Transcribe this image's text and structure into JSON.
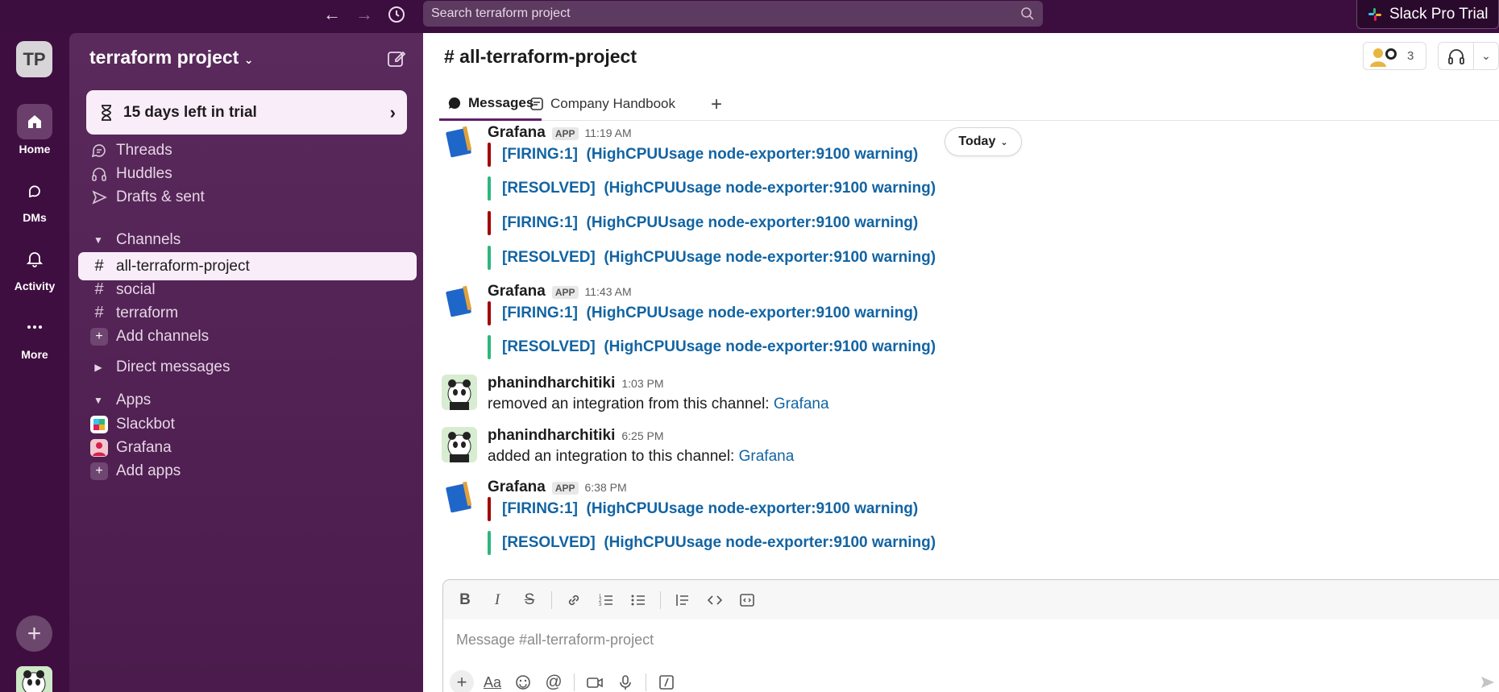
{
  "topbar": {
    "search_placeholder": "Search terraform project",
    "trial_label": "Slack Pro Trial",
    "icons": [
      "back-arrow-icon",
      "forward-arrow-icon",
      "history-clock-icon",
      "search-icon",
      "slack-logo-icon"
    ]
  },
  "rail": {
    "workspace_initials": "TP",
    "items": [
      {
        "label": "Home",
        "icon": "home-icon",
        "active": true
      },
      {
        "label": "DMs",
        "icon": "dms-icon",
        "active": false
      },
      {
        "label": "Activity",
        "icon": "bell-icon",
        "active": false
      },
      {
        "label": "More",
        "icon": "more-dots-icon",
        "active": false
      }
    ]
  },
  "sidebar": {
    "workspace_name": "terraform project",
    "trial_banner": "15 days left in trial",
    "nav": [
      {
        "label": "Threads",
        "icon": "threads-icon"
      },
      {
        "label": "Huddles",
        "icon": "headphones-icon"
      },
      {
        "label": "Drafts & sent",
        "icon": "send-icon"
      }
    ],
    "channels_header": "Channels",
    "channels": [
      {
        "label": "all-terraform-project",
        "active": true
      },
      {
        "label": "social",
        "active": false
      },
      {
        "label": "terraform",
        "active": false
      }
    ],
    "add_channels": "Add channels",
    "dm_header": "Direct messages",
    "apps_header": "Apps",
    "apps": [
      {
        "label": "Slackbot",
        "icon": "slackbot-icon"
      },
      {
        "label": "Grafana",
        "icon": "grafana-app-icon"
      }
    ],
    "add_apps": "Add apps"
  },
  "main": {
    "channel_title": "# all-terraform-project",
    "member_count": "3",
    "tabs": [
      {
        "label": "Messages",
        "active": true
      },
      {
        "label": "Company Handbook",
        "active": false
      }
    ],
    "date_divider": "Today",
    "messages": [
      {
        "author": "Grafana",
        "tag": "APP",
        "time": "11:19 AM",
        "alerts": [
          {
            "status": "[FIRING:1]",
            "text": "(HighCPUUsage node-exporter:9100 warning)",
            "color": "#a30200"
          },
          {
            "status": "[RESOLVED]",
            "text": "(HighCPUUsage node-exporter:9100 warning)",
            "color": "#2eb67d"
          },
          {
            "status": "[FIRING:1]",
            "text": "(HighCPUUsage node-exporter:9100 warning)",
            "color": "#a30200"
          },
          {
            "status": "[RESOLVED]",
            "text": "(HighCPUUsage node-exporter:9100 warning)",
            "color": "#2eb67d"
          }
        ]
      },
      {
        "author": "Grafana",
        "tag": "APP",
        "time": "11:43 AM",
        "alerts": [
          {
            "status": "[FIRING:1]",
            "text": "(HighCPUUsage node-exporter:9100 warning)",
            "color": "#a30200"
          },
          {
            "status": "[RESOLVED]",
            "text": "(HighCPUUsage node-exporter:9100 warning)",
            "color": "#2eb67d"
          }
        ]
      },
      {
        "author": "phanindharchitiki",
        "time": "1:03 PM",
        "text": "removed an integration from this channel:",
        "link": "Grafana"
      },
      {
        "author": "phanindharchitiki",
        "time": "6:25 PM",
        "text": "added an integration to this channel:",
        "link": "Grafana"
      },
      {
        "author": "Grafana",
        "tag": "APP",
        "time": "6:38 PM",
        "alerts": [
          {
            "status": "[FIRING:1]",
            "text": "(HighCPUUsage node-exporter:9100 warning)",
            "color": "#a30200"
          },
          {
            "status": "[RESOLVED]",
            "text": "(HighCPUUsage node-exporter:9100 warning)",
            "color": "#2eb67d"
          }
        ]
      }
    ]
  },
  "composer": {
    "placeholder": "Message #all-terraform-project",
    "format_buttons": [
      "bold-icon",
      "italic-icon",
      "strikethrough-icon",
      "link-icon",
      "ordered-list-icon",
      "bulleted-list-icon",
      "blockquote-icon",
      "code-icon",
      "code-block-icon"
    ],
    "bottom_buttons": [
      "plus-icon",
      "text-format-icon",
      "emoji-icon",
      "mention-icon",
      "video-icon",
      "microphone-icon",
      "slash-command-icon"
    ],
    "send_icon": "send-icon"
  },
  "colors": {
    "aubergine": "#3f0e40",
    "sidebar": "#4a1b4c",
    "link": "#1264a3",
    "firing": "#a30200",
    "resolved": "#2eb67d"
  }
}
